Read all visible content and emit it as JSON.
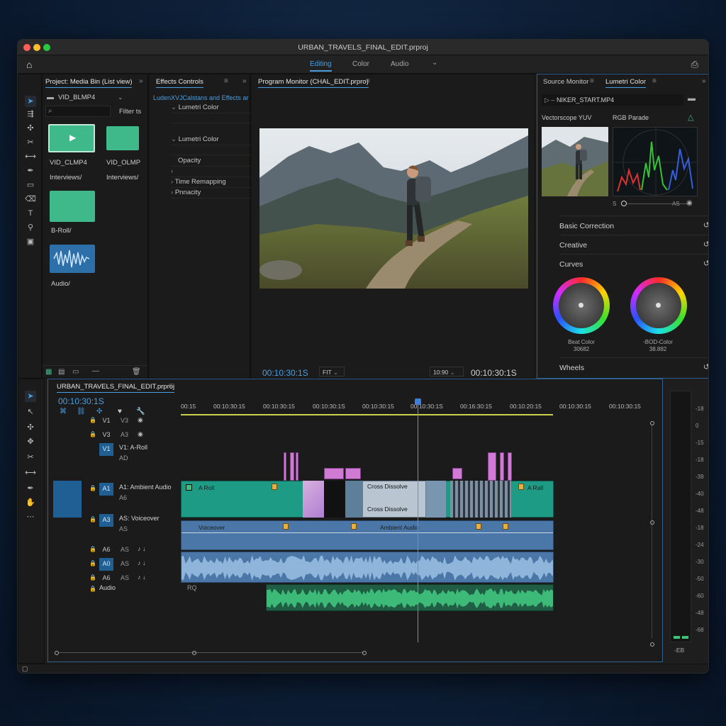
{
  "window": {
    "title": "URBAN_TRAVELS_FINAL_EDIT.prproj"
  },
  "workspace": {
    "tabs": [
      "Editing",
      "Color",
      "Audio"
    ],
    "active": "Editing"
  },
  "project_panel": {
    "tab": "Project: Media Bin (List view)",
    "filter_label": "Filter ts",
    "folder_selector": "VID_BLMP4",
    "items": [
      {
        "name": "VID_CLMP4",
        "type": "video",
        "color": "#3fb98a"
      },
      {
        "name": "VID_OLMP",
        "type": "folder",
        "color": "#3fb98a"
      },
      {
        "name": "Interviews/",
        "type": "label"
      },
      {
        "name": "Interviews/",
        "type": "label"
      },
      {
        "name": "B-Roll/",
        "type": "folder",
        "color": "#3fb98a"
      },
      {
        "name": "Audio/",
        "type": "audio",
        "color": "#2d6fa8"
      }
    ]
  },
  "effects_panel": {
    "tab": "Effects Controls",
    "link": "LudenXVJCalstans and Effects ar",
    "rows": [
      {
        "label": "Lumetri Color",
        "chevron": "v"
      },
      {
        "label": "",
        "chevron": ""
      },
      {
        "label": "Lumetri Color",
        "chevron": "v"
      },
      {
        "label": "",
        "chevron": ""
      },
      {
        "label": "Opacity",
        "chevron": ""
      },
      {
        "label": "",
        "chevron": ">"
      },
      {
        "label": "Time Remapping",
        "chevron": ">"
      },
      {
        "label": "Pnnacity",
        "chevron": ">"
      }
    ]
  },
  "program_monitor": {
    "tab": "Program Monitor (CHAL_EDIT.prpro)",
    "timecode_left": "00:10:30:1S",
    "fit": "FIT",
    "zoom": "10:90",
    "timecode_right": "00:10:30:1S",
    "playhead_fraction": 0.32
  },
  "source_panel": {
    "tabs": [
      "Source Monitor",
      "Lumetri Color"
    ],
    "clip": "NIKER_START.MP4",
    "scope_labels": [
      "Vectorscope YUV",
      "RGB Parade"
    ],
    "slider_left": "S",
    "slider_right": "AS",
    "sections": [
      "Basic Correction",
      "Creative",
      "Curves"
    ],
    "wheels": [
      {
        "label": "Beat Color",
        "value": "30682"
      },
      {
        "label": "-BOD-Color",
        "value": "38.882"
      }
    ],
    "footer": "Wheels"
  },
  "timeline": {
    "tab": "URBAN_TRAVELS_FINAL_EDIT.prproj",
    "timecode": "00:10:30:1S",
    "ruler": [
      "00:15",
      "00:10:30:15",
      "00:10:30:15",
      "00:10:30:1S",
      "00:10:30:15",
      "00:10:30:1S",
      "00:16:30:15",
      "00:10:20:15",
      "00:10:30:15",
      "00:10:30:15"
    ],
    "tracks": [
      {
        "a": "V1",
        "b": "V3"
      },
      {
        "a": "V3",
        "b": "A3"
      },
      {
        "a": "V1",
        "name": "V1: A-Roll",
        "sub": "AD"
      },
      {
        "a": "A1",
        "name": "A1: Ambient Audio",
        "sub": "A6"
      },
      {
        "a": "A3",
        "name": "AS: Voiceover",
        "sub": "AS"
      },
      {
        "a": "A6",
        "b": "AS"
      },
      {
        "a": "A0",
        "b": "AS"
      },
      {
        "a": "A6",
        "b": "AS"
      },
      {
        "a": "",
        "name": "Audio",
        "sub": "RQ"
      }
    ],
    "clips": {
      "a_roll_left": "A Roll",
      "a_roll_right": "A Rall",
      "transition_1": "Cross Dissolve",
      "transition_2": "Cross Dissolve",
      "voiceover": "Voiceover",
      "ambient": "Ambient Audio"
    }
  },
  "meters": {
    "labels": [
      "-18",
      "0",
      "-15",
      "-18",
      "-39",
      "-40",
      "-48",
      "-18",
      "-24",
      "-30",
      "-50",
      "-60",
      "-48",
      "-68"
    ],
    "unit": "-EB"
  },
  "colors": {
    "accent": "#4a9ee0",
    "video_clip": "#1e9b84",
    "audio_clip": "#4a77a8",
    "audio_green": "#3fbf7a",
    "marker": "#e9b040",
    "pink": "#d07ad6"
  }
}
